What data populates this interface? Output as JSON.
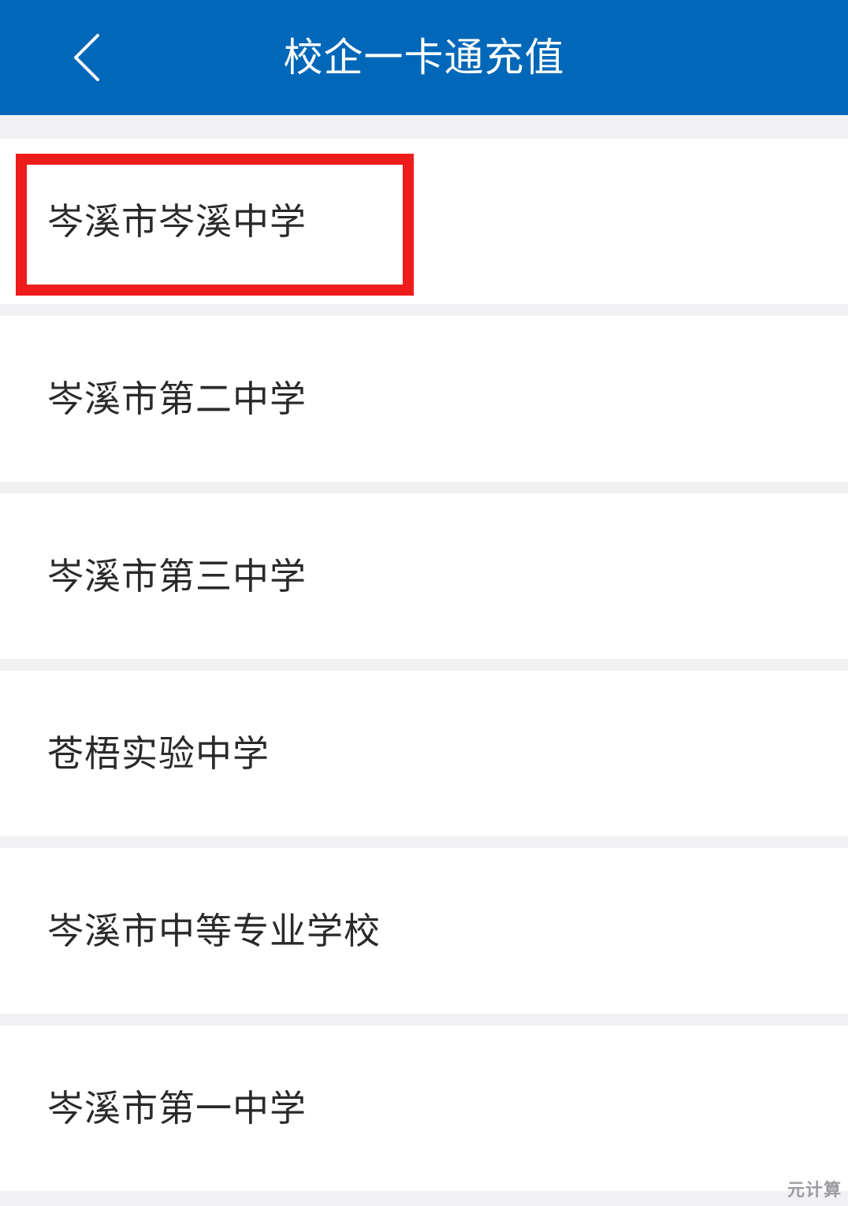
{
  "header": {
    "title": "校企一卡通充值",
    "back_icon": "chevron-left-icon",
    "background_color": "#0167b8",
    "text_color": "#ffffff"
  },
  "list": {
    "items": [
      {
        "label": "岑溪市岑溪中学",
        "highlighted": true
      },
      {
        "label": "岑溪市第二中学"
      },
      {
        "label": "岑溪市第三中学"
      },
      {
        "label": "苍梧实验中学"
      },
      {
        "label": "岑溪市中等专业学校"
      },
      {
        "label": "岑溪市第一中学"
      }
    ],
    "highlight_color": "#ee1c1c"
  },
  "watermark": "元计算"
}
